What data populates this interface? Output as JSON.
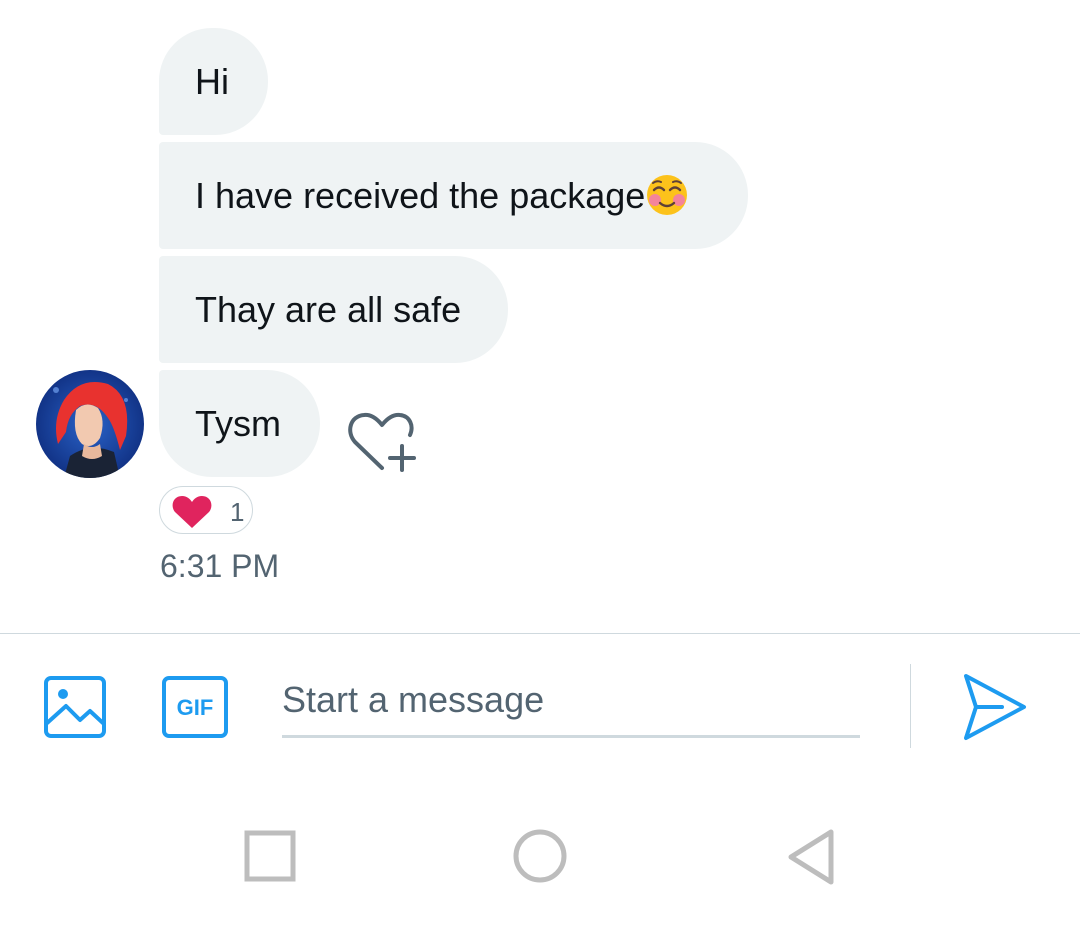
{
  "conversation": {
    "messages": [
      {
        "text": "Hi"
      },
      {
        "text": "I have received the package",
        "emoji": "smiling-face-with-blush"
      },
      {
        "text": "Thay are all safe"
      },
      {
        "text": "Tysm"
      }
    ],
    "reaction": {
      "icon": "red-heart-icon",
      "count": "1"
    },
    "timestamp": "6:31 PM"
  },
  "composer": {
    "placeholder": "Start a message",
    "gif_label": "GIF",
    "accent_color": "#1d9bf0"
  },
  "colors": {
    "bubble_bg": "#eff3f4",
    "text": "#0f1419",
    "secondary_text": "#536471",
    "border": "#cfd9de",
    "heart": "#e0245e"
  }
}
